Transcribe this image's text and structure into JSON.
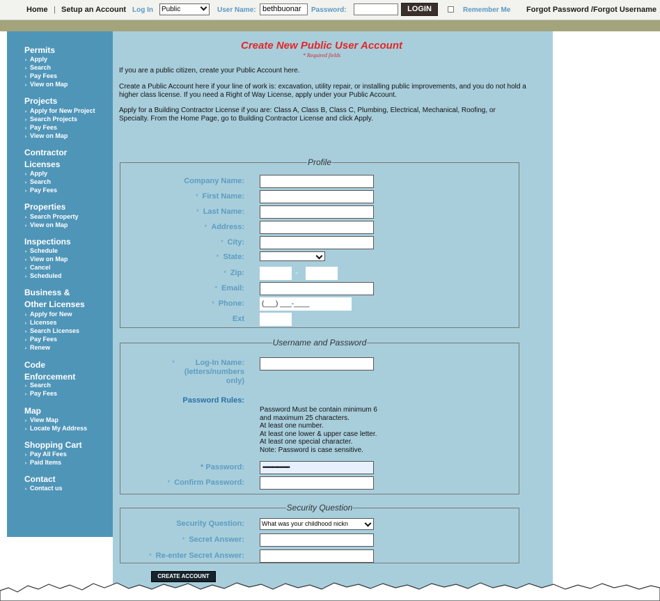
{
  "topbar": {
    "home": "Home",
    "separator": "|",
    "setup": "Setup an Account",
    "login_in_label": "Log In",
    "account_type": "Public",
    "username_label": "User Name:",
    "username_value": "bethbuonar",
    "password_label": "Password:",
    "password_value": "",
    "login_button": "LOGIN",
    "remember_me": "Remember Me",
    "forgot": "Forgot Password /Forgot Username"
  },
  "sidebar": {
    "permits": {
      "heading": "Permits",
      "items": [
        "Apply",
        "Search",
        "Pay Fees",
        "View on Map"
      ]
    },
    "projects": {
      "heading": "Projects",
      "items": [
        "Apply for New Project",
        "Search Projects",
        "Pay Fees",
        "View on Map"
      ]
    },
    "contractor": {
      "heading_1": "Contractor",
      "heading_2": "Licenses",
      "items": [
        "Apply",
        "Search",
        "Pay Fees"
      ]
    },
    "properties": {
      "heading": "Properties",
      "items": [
        "Search Property",
        "View on Map"
      ]
    },
    "inspections": {
      "heading": "Inspections",
      "items": [
        "Schedule",
        "View on Map",
        "Cancel",
        "Scheduled"
      ]
    },
    "business": {
      "heading_1": "Business &",
      "heading_2": "Other Licenses",
      "items": [
        "Apply for New",
        "Licenses",
        "Search Licenses",
        "Pay Fees",
        "Renew"
      ]
    },
    "code": {
      "heading_1": "Code",
      "heading_2": "Enforcement",
      "items": [
        "Search",
        "Pay Fees"
      ]
    },
    "map": {
      "heading": "Map",
      "items": [
        "View Map",
        "Locate My Address"
      ]
    },
    "cart": {
      "heading": "Shopping Cart",
      "items": [
        "Pay All Fees",
        "Paid Items"
      ]
    },
    "contact": {
      "heading": "Contact",
      "items": [
        "Contact us"
      ]
    }
  },
  "main": {
    "title": "Create New Public User Account",
    "required_note": "* Required fields",
    "intro": [
      "If you are a public citizen, create your Public Account here.",
      "Create a Public Account here if your line of work is: excavation, utility repair, or installing public improvements, and you do not hold a higher class license. If you need a Right of Way License, apply under your Public Account.",
      "Apply for a Building Contractor License if you are: Class A, Class B, Class C, Plumbing, Electrical, Mechanical, Roofing, or Specialty. From the Home Page, go to Building Contractor License and click Apply."
    ],
    "profile": {
      "legend": "Profile",
      "star": "*",
      "company": "Company Name:",
      "first_name": "First Name:",
      "last_name": "Last Name:",
      "address": "Address:",
      "city": "City:",
      "state": "State:",
      "state_value": "",
      "zip": "Zip:",
      "zip_sep": "-",
      "email": "Email:",
      "phone": "Phone:",
      "phone_placeholder": "(___) ___-____",
      "ext": "Ext"
    },
    "credentials": {
      "legend": "Username and Password",
      "login_name_1": "Log-In Name:",
      "login_name_2": "(letters/numbers",
      "login_name_3": "only)",
      "password_rules_label": "Password Rules:",
      "rules": [
        "Password Must be contain minimum 6",
        "and maximum 25 characters.",
        "At least one number.",
        "At least one lower & upper case letter.",
        "At least one special character.",
        "Note: Password is case sensitive."
      ],
      "password": "* Password:",
      "password_mask": "••••••••••••••••••",
      "confirm_password": "Confirm Password:"
    },
    "security": {
      "legend": "Security Question",
      "question_label": "Security Question:",
      "question_value": "What was your childhood nickn",
      "secret_answer": "Secret Answer:",
      "reenter": "Re-enter Secret Answer:"
    },
    "create_button": "CREATE ACCOUNT"
  },
  "colors": {
    "sidebar": "#4f95b8",
    "main_panel": "#a8cedc",
    "label_blue": "#5e9cc0",
    "title_red": "#e02828",
    "olive_bar": "#a4a47c",
    "login_button": "#3a2f2a"
  }
}
